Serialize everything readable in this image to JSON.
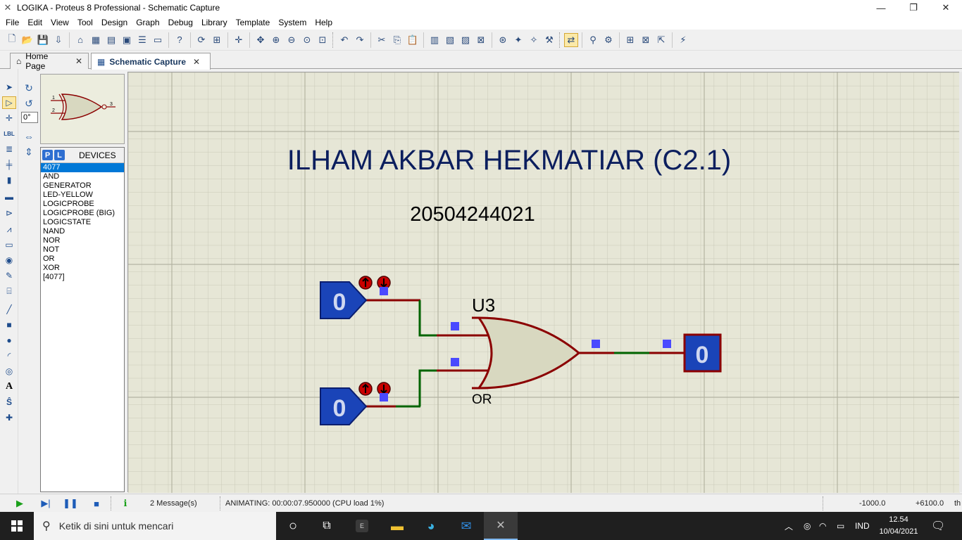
{
  "window": {
    "title": "LOGIKA - Proteus 8 Professional - Schematic Capture",
    "minimize": "—",
    "restore": "❐",
    "close": "✕"
  },
  "menu": [
    "File",
    "Edit",
    "View",
    "Tool",
    "Design",
    "Graph",
    "Debug",
    "Library",
    "Template",
    "System",
    "Help"
  ],
  "tabs": [
    {
      "label": "Home Page",
      "close": "✕"
    },
    {
      "label": "Schematic Capture",
      "close": "✕"
    }
  ],
  "rotation": {
    "angle": "0°"
  },
  "devices_panel": {
    "p_label": "P",
    "l_label": "L",
    "title": "DEVICES",
    "items": [
      "4077",
      "AND",
      "GENERATOR",
      "LED-YELLOW",
      "LOGICPROBE",
      "LOGICPROBE (BIG)",
      "LOGICSTATE",
      "NAND",
      "NOR",
      "NOT",
      "OR",
      "XOR",
      "[4077]"
    ],
    "selected": "4077"
  },
  "preview": {
    "pin1": "1",
    "pin2": "2",
    "pin3": "3"
  },
  "schematic": {
    "title_text": "ILHAM AKBAR HEKMATIAR (C2.1)",
    "subtitle_text": "20504244021",
    "gate_ref": "U3",
    "gate_type": "OR",
    "input_a_state": "0",
    "input_b_state": "0",
    "output_probe_state": "0",
    "colors": {
      "canvas": "#e6e6d6",
      "grid": "#c8c8b8",
      "grid_major": "#b8b8a8",
      "wire_red": "#8b0000",
      "wire_green": "#006400",
      "state_blue": "#1a44b8",
      "state_blue_dark": "#0b1e6e",
      "pin_marker": "#4a4aff",
      "gate_fill": "#d8d8c0"
    }
  },
  "statusbar": {
    "messages": "2 Message(s)",
    "animation": "ANIMATING: 00:00:07.950000 (CPU load 1%)",
    "coord_x": "-1000.0",
    "coord_y": "+6100.0",
    "unit": "th"
  },
  "taskbar": {
    "search_placeholder": "Ketik di sini untuk mencari",
    "language": "IND",
    "time": "12.54",
    "date": "10/04/2021",
    "e_label": "E"
  }
}
